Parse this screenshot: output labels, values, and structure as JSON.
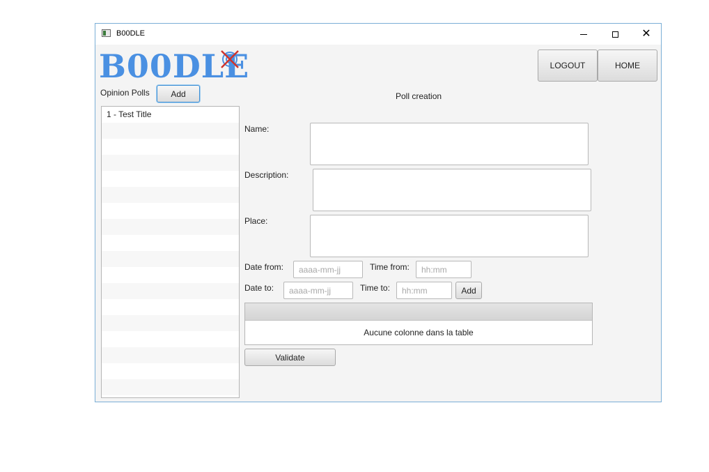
{
  "window": {
    "title": "B00DLE",
    "min_glyph": "",
    "close_glyph": "✕"
  },
  "logo": {
    "text": "B00DLE"
  },
  "header": {
    "logout_label": "LOGOUT",
    "home_label": "HOME"
  },
  "sidebar": {
    "title": "Opinion Polls",
    "add_label": "Add",
    "items": [
      "1 - Test Title"
    ]
  },
  "form": {
    "heading": "Poll creation",
    "name_label": "Name:",
    "description_label": "Description:",
    "place_label": "Place:",
    "date_from_label": "Date from:",
    "date_from_placeholder": "aaaa-mm-jj",
    "time_from_label": "Time from:",
    "time_from_placeholder": "hh:mm",
    "date_to_label": "Date to:",
    "date_to_placeholder": "aaaa-mm-jj",
    "time_to_label": "Time to:",
    "time_to_placeholder": "hh:mm",
    "add_label": "Add",
    "table_empty_text": "Aucune colonne dans la table",
    "validate_label": "Validate"
  },
  "colors": {
    "accent": "#4a90e2",
    "window_border": "#7aaed6",
    "logo_mark": "#d0342c"
  }
}
